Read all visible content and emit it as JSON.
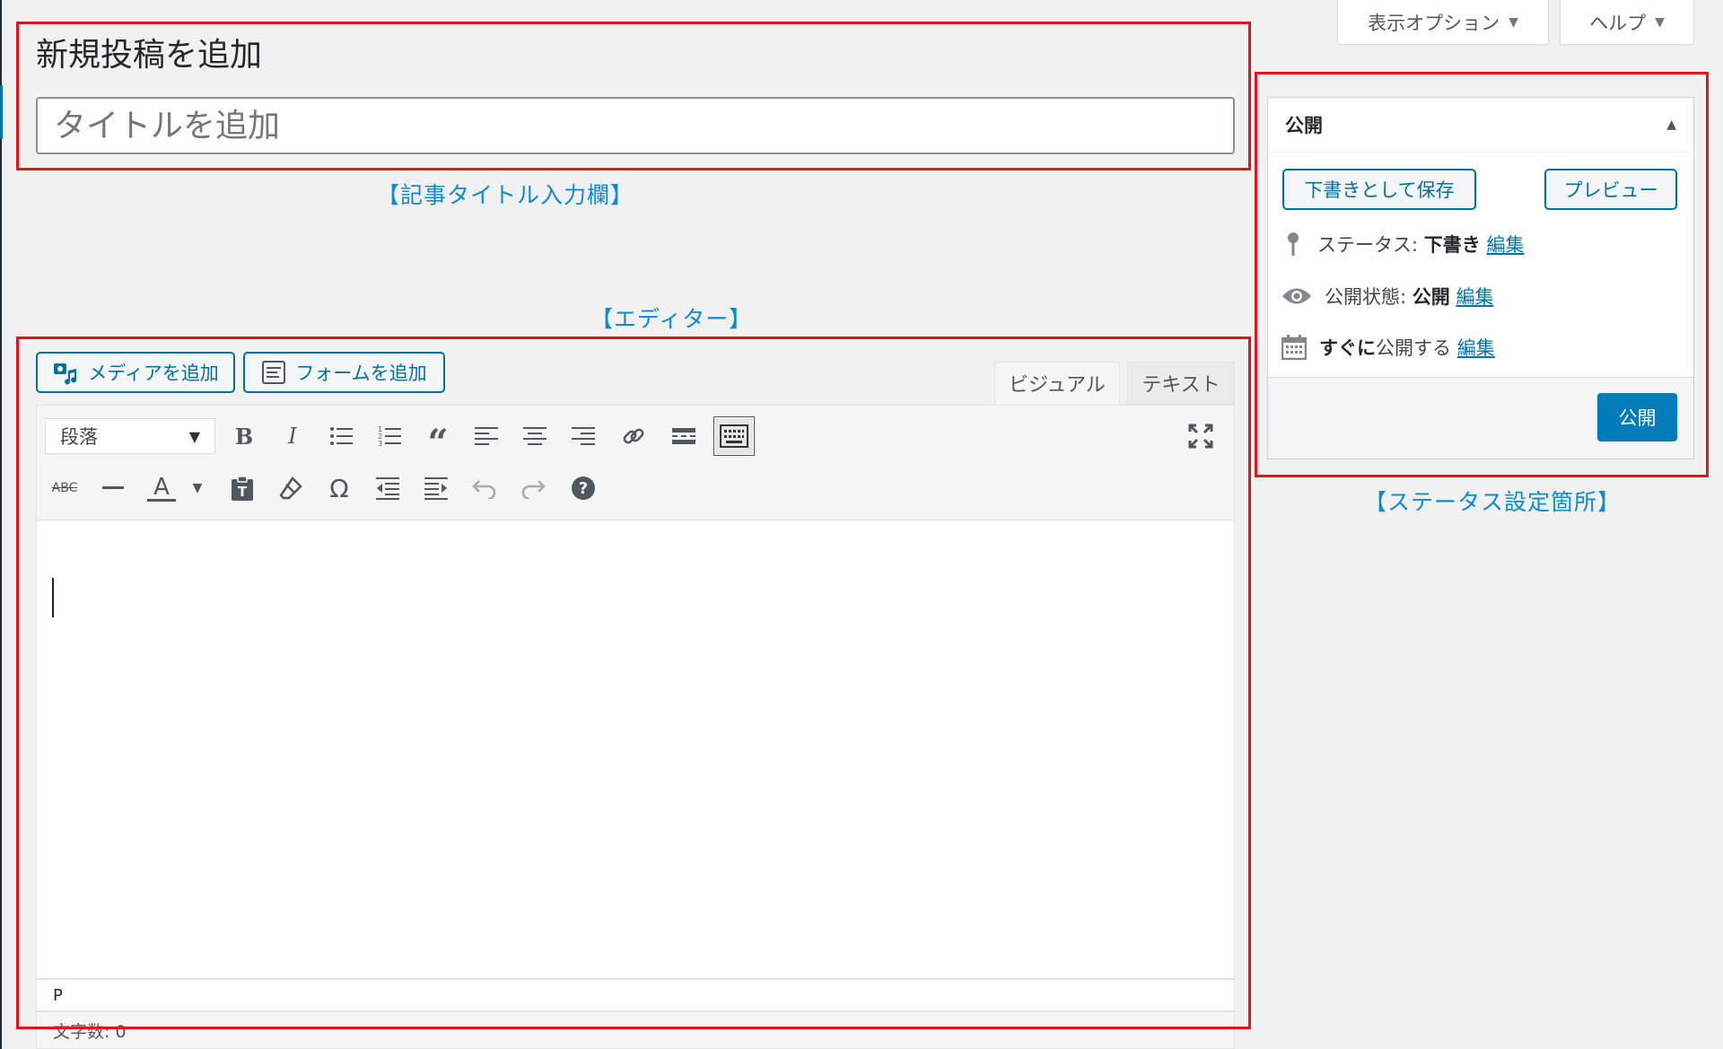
{
  "screen_options": {
    "display_options_label": "表示オプション",
    "help_label": "ヘルプ"
  },
  "page_title": "新規投稿を追加",
  "title_input": {
    "placeholder": "タイトルを追加",
    "value": ""
  },
  "annotations": {
    "title_field": "【記事タイトル入力欄】",
    "editor": "【エディター】",
    "status": "【ステータス設定箇所】"
  },
  "editor": {
    "add_media_label": "メディアを追加",
    "add_form_label": "フォームを追加",
    "tabs": [
      {
        "label": "ビジュアル",
        "active": true
      },
      {
        "label": "テキスト",
        "active": false
      }
    ],
    "format_select": "段落",
    "toolbar_row1": [
      "bold",
      "italic",
      "bullet-list",
      "numbered-list",
      "blockquote",
      "align-left",
      "align-center",
      "align-right",
      "link",
      "read-more",
      "toolbar-toggle",
      "fullscreen"
    ],
    "toolbar_row2": [
      "strikethrough",
      "horizontal-line",
      "text-color",
      "paste-as-text",
      "clear-formatting",
      "special-character",
      "outdent",
      "indent",
      "undo",
      "redo",
      "help"
    ],
    "path": "P",
    "word_count": "文字数: 0"
  },
  "publish_box": {
    "title": "公開",
    "save_draft_label": "下書きとして保存",
    "preview_label": "プレビュー",
    "status_label": "ステータス:",
    "status_value": "下書き",
    "visibility_label": "公開状態:",
    "visibility_value": "公開",
    "schedule_bold": "すぐに",
    "schedule_label": "公開する",
    "edit_label": "編集",
    "publish_label": "公開"
  },
  "colors": {
    "annotation_box": "#e0141e",
    "annotation_text": "#0a8bd6",
    "primary": "#007cba",
    "link": "#0073aa"
  }
}
